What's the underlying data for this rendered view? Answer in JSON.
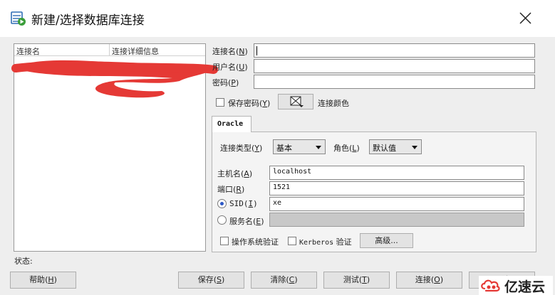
{
  "window": {
    "title": "新建/选择数据库连接"
  },
  "connections": {
    "col_name": "连接名",
    "col_details": "连接详细信息"
  },
  "form": {
    "conn_name_label": "连接名",
    "conn_name_key": "N",
    "conn_name_value": "",
    "username_label": "用户名",
    "username_key": "U",
    "username_value": "",
    "password_label": "密码",
    "password_key": "P",
    "password_value": "",
    "save_password_label": "保存密码",
    "save_password_key": "Y",
    "save_password_checked": false,
    "conn_color_label": "连接颜色"
  },
  "tab": {
    "label": "Oracle"
  },
  "oracle": {
    "conn_type_label": "连接类型",
    "conn_type_key": "Y",
    "conn_type_value": "基本",
    "role_label": "角色",
    "role_key": "L",
    "role_value": "默认值",
    "host_label": "主机名",
    "host_key": "A",
    "host_value": "localhost",
    "port_label": "端口",
    "port_key": "R",
    "port_value": "1521",
    "sid_label": "SID",
    "sid_key": "I",
    "sid_value": "xe",
    "sid_selected": true,
    "service_label": "服务名",
    "service_key": "E",
    "service_value": "",
    "os_auth_label": "操作系统验证",
    "kerberos_prefix": "Kerberos",
    "kerberos_suffix": "验证",
    "advanced_label": "高级..."
  },
  "status": {
    "label": "状态:"
  },
  "buttons": {
    "help": "帮助",
    "help_key": "H",
    "save": "保存",
    "save_key": "S",
    "clear": "清除",
    "clear_key": "C",
    "test": "测试",
    "test_key": "T",
    "connect": "连接",
    "connect_key": "O",
    "cancel": "取消"
  },
  "watermark": {
    "text": "亿速云"
  },
  "colors": {
    "scribble": "#e53935",
    "radio_dot": "#2b57c5",
    "app_icon": "#2f6db5"
  }
}
